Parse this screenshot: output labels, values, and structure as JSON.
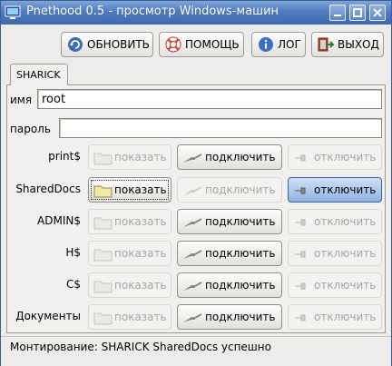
{
  "window": {
    "title": "Pnethood 0.5 - просмотр Windows-машин"
  },
  "toolbar": {
    "refresh_label": "ОБНОВИТЬ",
    "help_label": "ПОМОЩЬ",
    "log_label": "ЛОГ",
    "exit_label": "ВЫХОД"
  },
  "tabs": [
    {
      "label": "SHARICK"
    }
  ],
  "login": {
    "name_label": "имя",
    "name_value": "root",
    "password_label": "пароль",
    "password_value": ""
  },
  "shares": [
    {
      "name": "print$",
      "show_label": "показать",
      "connect_label": "подключить",
      "disconnect_label": "отключить"
    },
    {
      "name": "SharedDocs",
      "show_label": "показать",
      "connect_label": "подключить",
      "disconnect_label": "отключить"
    },
    {
      "name": "ADMIN$",
      "show_label": "показать",
      "connect_label": "подключить",
      "disconnect_label": "отключить"
    },
    {
      "name": "H$",
      "show_label": "показать",
      "connect_label": "подключить",
      "disconnect_label": "отключить"
    },
    {
      "name": "C$",
      "show_label": "показать",
      "connect_label": "подключить",
      "disconnect_label": "отключить"
    },
    {
      "name": "Документы",
      "show_label": "показать",
      "connect_label": "подключить",
      "disconnect_label": "отключить"
    }
  ],
  "status": {
    "text": "Монтирование: SHARICK SharedDocs успешно"
  },
  "colors": {
    "titlebar": "#4f7cc0",
    "active_button": "#8fb2e3",
    "window_bg": "#edeceb"
  }
}
